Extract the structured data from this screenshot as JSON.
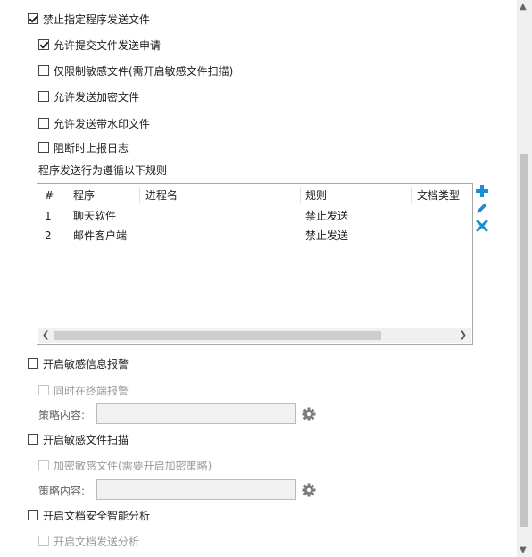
{
  "options": {
    "block_send": "禁止指定程序发送文件",
    "allow_submit": "允许提交文件发送申请",
    "only_sensitive": "仅限制敏感文件(需开启敏感文件扫描)",
    "allow_encrypted": "允许发送加密文件",
    "allow_watermark": "允许发送带水印文件",
    "report_log": "阻断时上报日志"
  },
  "rules": {
    "caption": "程序发送行为遵循以下规则",
    "columns": [
      "#",
      "程序",
      "进程名",
      "规则",
      "文档类型"
    ],
    "rows": [
      {
        "num": "1",
        "program": "聊天软件",
        "process": "",
        "rule": "禁止发送",
        "doctype": ""
      },
      {
        "num": "2",
        "program": "邮件客户端",
        "process": "",
        "rule": "禁止发送",
        "doctype": ""
      }
    ],
    "actions": {
      "add": "plus-icon",
      "edit": "pencil-icon",
      "delete": "x-icon"
    },
    "accent": "#1b8ed1"
  },
  "alert": {
    "enable": "开启敏感信息报警",
    "terminal": "同时在终端报警",
    "policy_label": "策略内容:",
    "policy_value": ""
  },
  "scan": {
    "enable": "开启敏感文件扫描",
    "encrypt": "加密敏感文件(需要开启加密策略)",
    "policy_label": "策略内容:",
    "policy_value": ""
  },
  "smart": {
    "enable": "开启文档安全智能分析",
    "send_analysis": "开启文档发送分析"
  }
}
